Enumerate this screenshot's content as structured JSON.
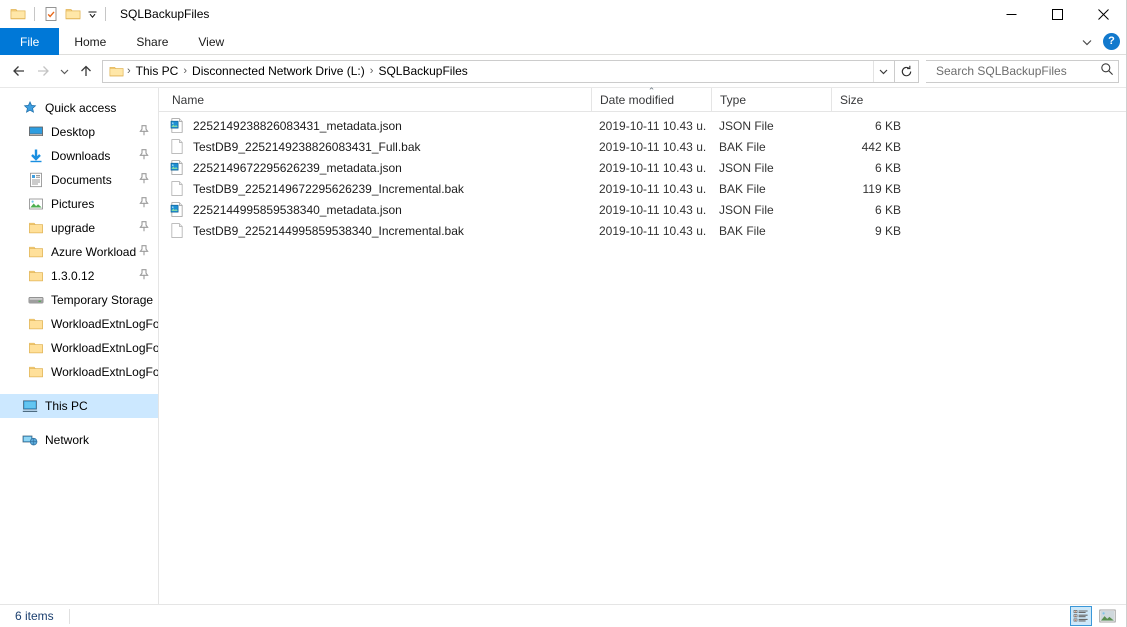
{
  "window": {
    "title": "SQLBackupFiles",
    "quick_access_toolbar": [
      {
        "name": "folder-icon",
        "label": "Properties folder"
      },
      {
        "name": "properties-icon",
        "label": "Properties"
      },
      {
        "name": "new-folder-icon",
        "label": "New folder"
      },
      {
        "name": "chevron-down-icon",
        "label": "Customize Quick Access Toolbar"
      }
    ],
    "controls": {
      "minimize": "—",
      "maximize": "☐",
      "close": "✕"
    }
  },
  "ribbon": {
    "tabs": [
      {
        "label": "File",
        "active": true
      },
      {
        "label": "Home",
        "active": false
      },
      {
        "label": "Share",
        "active": false
      },
      {
        "label": "View",
        "active": false
      }
    ],
    "expand_label": "∨",
    "help_label": "?"
  },
  "address": {
    "back_label": "←",
    "forward_label": "→",
    "recent_label": "∨",
    "up_label": "↑",
    "separator": "›",
    "breadcrumbs": [
      "This PC",
      "Disconnected Network Drive (L:)",
      "SQLBackupFiles"
    ],
    "dropdown_label": "∨",
    "refresh_label": "↻"
  },
  "search": {
    "placeholder": "Search SQLBackupFiles",
    "value": "",
    "icon": "search-icon"
  },
  "sidebar": {
    "items": [
      {
        "label": "Quick access",
        "icon": "star-icon",
        "kind": "group",
        "pinned": false,
        "selected": false
      },
      {
        "label": "Desktop",
        "icon": "desktop-icon",
        "kind": "child",
        "pinned": true,
        "selected": false
      },
      {
        "label": "Downloads",
        "icon": "downloads-icon",
        "kind": "child",
        "pinned": true,
        "selected": false
      },
      {
        "label": "Documents",
        "icon": "documents-icon",
        "kind": "child",
        "pinned": true,
        "selected": false
      },
      {
        "label": "Pictures",
        "icon": "pictures-icon",
        "kind": "child",
        "pinned": true,
        "selected": false
      },
      {
        "label": "upgrade",
        "icon": "folder-icon",
        "kind": "child",
        "pinned": true,
        "selected": false
      },
      {
        "label": "Azure Workload",
        "icon": "folder-icon",
        "kind": "child",
        "pinned": true,
        "selected": false
      },
      {
        "label": "1.3.0.12",
        "icon": "folder-icon",
        "kind": "child",
        "pinned": true,
        "selected": false
      },
      {
        "label": "Temporary Storage",
        "icon": "drive-icon",
        "kind": "child",
        "pinned": false,
        "selected": false
      },
      {
        "label": "WorkloadExtnLogFo",
        "icon": "folder-icon",
        "kind": "child",
        "pinned": false,
        "selected": false
      },
      {
        "label": "WorkloadExtnLogFo",
        "icon": "folder-icon",
        "kind": "child",
        "pinned": false,
        "selected": false
      },
      {
        "label": "WorkloadExtnLogFo",
        "icon": "folder-icon",
        "kind": "child",
        "pinned": false,
        "selected": false
      },
      {
        "label": "This PC",
        "icon": "this-pc-icon",
        "kind": "group",
        "pinned": false,
        "selected": true
      },
      {
        "label": "Network",
        "icon": "network-icon",
        "kind": "group",
        "pinned": false,
        "selected": false
      }
    ]
  },
  "filelist": {
    "columns": [
      {
        "label": "Name",
        "sorted": false
      },
      {
        "label": "Date modified",
        "sorted": true,
        "sort_direction": "asc",
        "caret": "⌃"
      },
      {
        "label": "Type",
        "sorted": false
      },
      {
        "label": "Size",
        "sorted": false
      }
    ],
    "rows": [
      {
        "name": "2252149238826083431_metadata.json",
        "date_modified": "2019-10-11 10.43 u.",
        "type": "JSON File",
        "size": "6 KB",
        "icon": "json-file-icon"
      },
      {
        "name": "TestDB9_2252149238826083431_Full.bak",
        "date_modified": "2019-10-11 10.43 u.",
        "type": "BAK File",
        "size": "442 KB",
        "icon": "generic-file-icon"
      },
      {
        "name": "2252149672295626239_metadata.json",
        "date_modified": "2019-10-11 10.43 u.",
        "type": "JSON File",
        "size": "6 KB",
        "icon": "json-file-icon"
      },
      {
        "name": "TestDB9_2252149672295626239_Incremental.bak",
        "date_modified": "2019-10-11 10.43 u.",
        "type": "BAK File",
        "size": "119 KB",
        "icon": "generic-file-icon"
      },
      {
        "name": "2252144995859538340_metadata.json",
        "date_modified": "2019-10-11 10.43 u.",
        "type": "JSON File",
        "size": "6 KB",
        "icon": "json-file-icon"
      },
      {
        "name": "TestDB9_2252144995859538340_Incremental.bak",
        "date_modified": "2019-10-11 10.43 u.",
        "type": "BAK File",
        "size": "9 KB",
        "icon": "generic-file-icon"
      }
    ]
  },
  "statusbar": {
    "item_count": "6 items",
    "views": [
      {
        "name": "details-view-button",
        "active": true
      },
      {
        "name": "large-icons-view-button",
        "active": false
      }
    ]
  },
  "colors": {
    "accent": "#0078d7",
    "selection": "#cce8ff",
    "hover": "#e5f3ff",
    "folder": "#fcd88b",
    "status_text": "#1a3e6e"
  }
}
